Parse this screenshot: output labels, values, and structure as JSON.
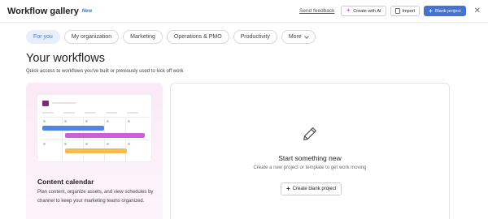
{
  "header": {
    "title": "Workflow gallery",
    "badge": "New",
    "send_feedback": "Send feedback",
    "create_with_ai": "Create with AI",
    "import": "Import",
    "blank_project": "Blank project",
    "close_icon": "close-icon"
  },
  "tabs": [
    {
      "label": "For you",
      "active": true
    },
    {
      "label": "My organization"
    },
    {
      "label": "Marketing"
    },
    {
      "label": "Operations & PMO"
    },
    {
      "label": "Productivity"
    },
    {
      "label": "More"
    }
  ],
  "section": {
    "heading": "Your workflows",
    "subheading": "Quick access to workflows you've built or previously used to kick off work"
  },
  "workflow_card": {
    "title": "Content calendar",
    "description": "Plan content, organize assets, and view schedules by channel to keep your marketing teams organized."
  },
  "blank_card": {
    "title": "Start something new",
    "description": "Create a new project or template to get work moving",
    "button": "Create blank project"
  },
  "colors": {
    "accent": "#4573d2",
    "ai_icon": "#d05ed9",
    "gantt_blue": "#4f86e4",
    "gantt_purple": "#d05ed9",
    "gantt_yellow": "#f4bc4f",
    "card_tint": "#fbe9f6"
  }
}
